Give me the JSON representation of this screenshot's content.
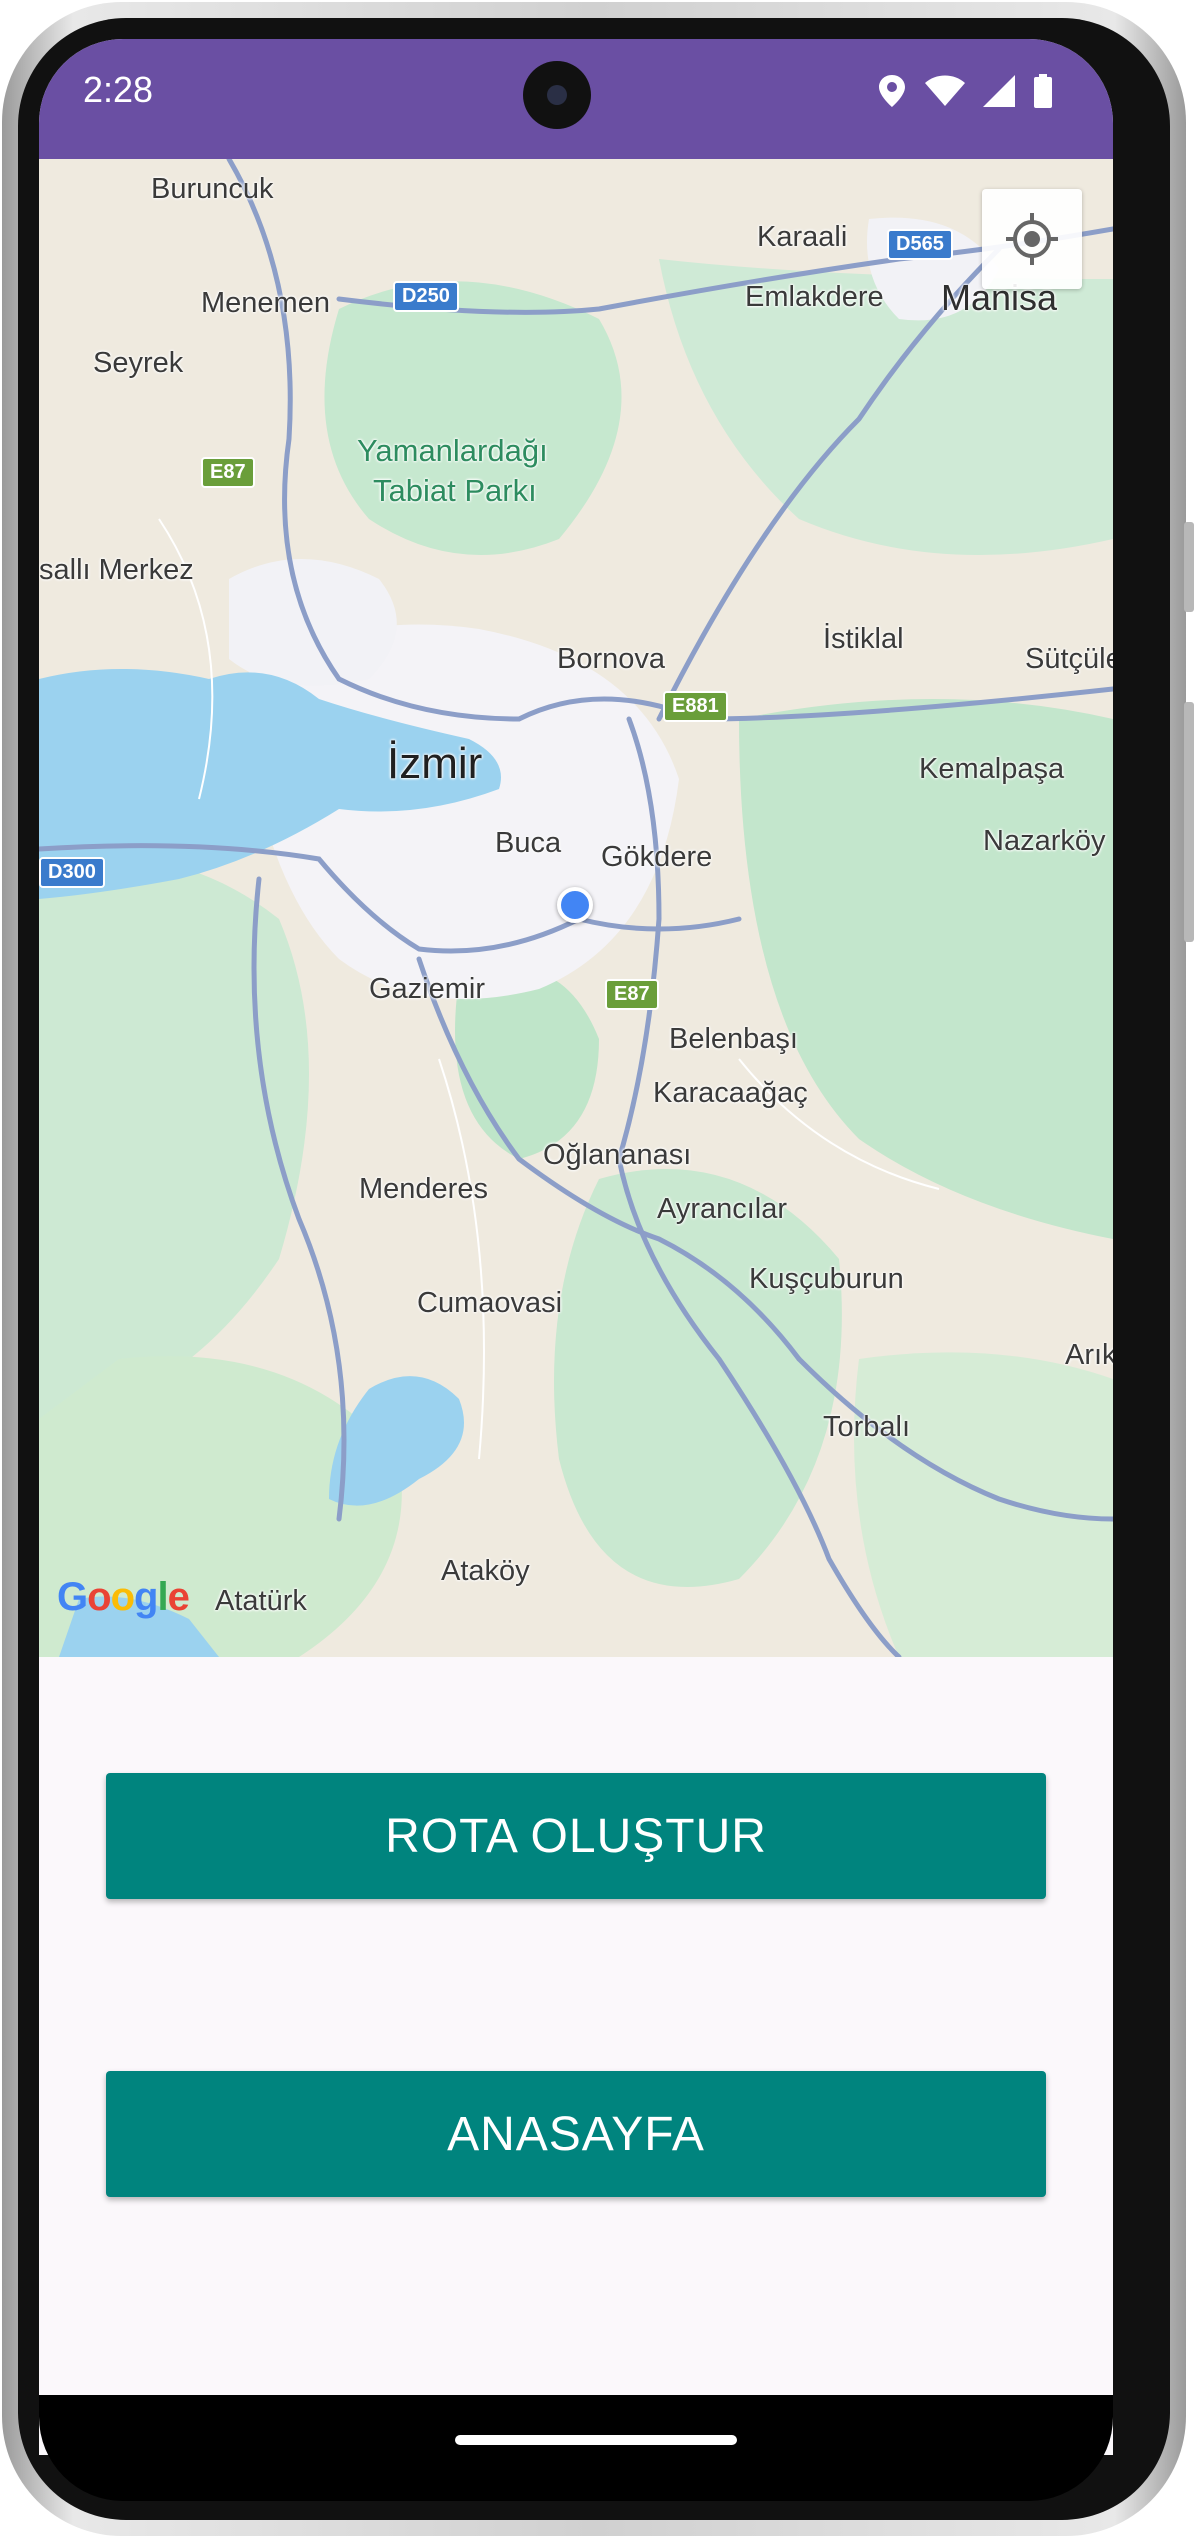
{
  "status_bar": {
    "time": "2:28",
    "icons": [
      "location-icon",
      "wifi-icon",
      "signal-icon",
      "battery-icon"
    ],
    "background": "#6a4fa3"
  },
  "map": {
    "provider_logo": "Google",
    "user_location_color": "#4285f4",
    "locate_button_icon": "my-location-icon",
    "labels": {
      "buruncuk": "Buruncuk",
      "karaali": "Karaali",
      "menemen": "Menemen",
      "emlakdere": "Emlakdere",
      "manisa": "Manisa",
      "seyrek": "Seyrek",
      "yamanlardagi": "Yamanlardağı",
      "tabiat_parki": "Tabiat Parkı",
      "salli_merkez": "sallı Merkez",
      "istiklal": "İstiklal",
      "bornova": "Bornova",
      "sutculer": "Sütçüler",
      "izmir": "İzmir",
      "kemalpasa": "Kemalpaşa",
      "buca": "Buca",
      "gokdere": "Gökdere",
      "nazarkoy": "Nazarköy",
      "gaziemir": "Gaziemir",
      "belenbasi": "Belenbaşı",
      "karacaagac": "Karacaağaç",
      "oglananasi": "Oğlananası",
      "menderes": "Menderes",
      "ayrancilar": "Ayrancılar",
      "kuscuburun": "Kuşçuburun",
      "cumaovasi": "Cumaovasi",
      "arik": "Arık",
      "torbali": "Torbalı",
      "atakoy": "Ataköy",
      "ataturk": "Atatürk"
    },
    "shields": {
      "d250": "D250",
      "d565": "D565",
      "e87_north": "E87",
      "e881": "E881",
      "d300": "D300",
      "e87_south": "E87"
    }
  },
  "buttons": {
    "create_route": "ROTA OLUŞTUR",
    "home": "ANASAYFA"
  },
  "colors": {
    "button": "#00847e",
    "screen_background": "#fbf8fb"
  }
}
